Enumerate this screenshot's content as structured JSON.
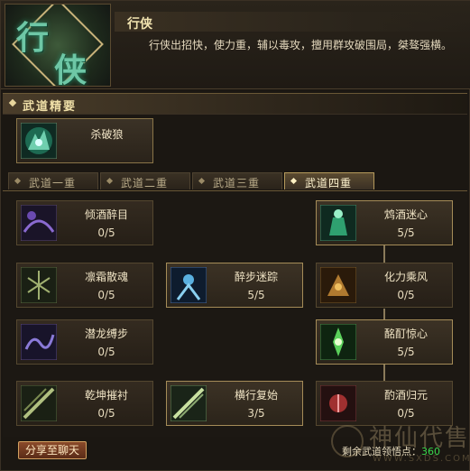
{
  "header": {
    "emblem_glyph_1": "行",
    "emblem_glyph_2": "侠",
    "class_title": "行侠",
    "class_desc": "行侠出招快，使力重，辅以毒攻，擅用群攻破围局，桀骜强横。"
  },
  "section": {
    "title": "武道精要"
  },
  "ultimate": {
    "name": "杀破狼",
    "icon": "wolf-spirit-icon"
  },
  "tabs": [
    {
      "label": "武道一重",
      "active": false
    },
    {
      "label": "武道二重",
      "active": false
    },
    {
      "label": "武道三重",
      "active": false
    },
    {
      "label": "武道四重",
      "active": true
    }
  ],
  "skills": {
    "qingjiu": {
      "name": "倾酒醉目",
      "level": "0/5",
      "icon": "wine-eye-icon",
      "color": "#5a3a8a"
    },
    "zhenjiu": {
      "name": "鸩酒迷心",
      "level": "5/5",
      "icon": "poison-wine-icon",
      "color": "#2f8a5a"
    },
    "linshuang": {
      "name": "凛霜散魂",
      "level": "0/5",
      "icon": "frost-soul-icon",
      "color": "#4a5a3a"
    },
    "zuibu": {
      "name": "醉步迷踪",
      "level": "5/5",
      "icon": "drunk-step-icon",
      "color": "#2a5a8a"
    },
    "huali": {
      "name": "化力乘风",
      "level": "0/5",
      "icon": "wind-power-icon",
      "color": "#6a4a20"
    },
    "qianlong": {
      "name": "潜龙缚步",
      "level": "0/5",
      "icon": "dragon-bind-icon",
      "color": "#4a3a7a"
    },
    "mingding": {
      "name": "酩酊惊心",
      "level": "5/5",
      "icon": "drunk-shock-icon",
      "color": "#3a9a3a"
    },
    "qiankun": {
      "name": "乾坤摧衬",
      "level": "0/5",
      "icon": "heaven-earth-icon",
      "color": "#4a5a3a"
    },
    "hengxing": {
      "name": "横行复始",
      "level": "3/5",
      "icon": "rampage-icon",
      "color": "#5a7a4a"
    },
    "yunjiu": {
      "name": "酌酒归元",
      "level": "0/5",
      "icon": "wine-return-icon",
      "color": "#7a2a2a"
    }
  },
  "footer": {
    "share_label": "分享至聊天",
    "points_label": "剩余武道领悟点：",
    "points_value": "360",
    "watermark_text": "神仙代售",
    "watermark_url": "WWW.SXDS.COM"
  }
}
